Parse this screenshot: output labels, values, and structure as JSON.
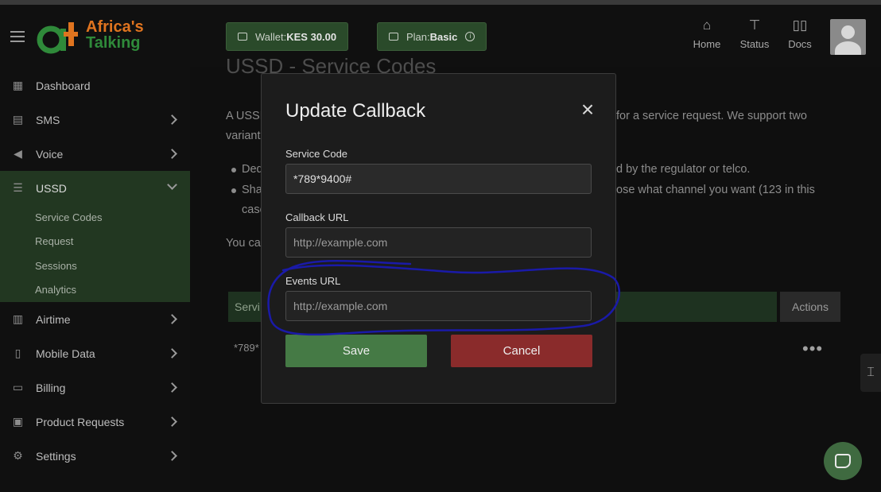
{
  "brand": {
    "line1": "Africa's",
    "line2": "Talking"
  },
  "sidebar": {
    "items": [
      {
        "label": "Dashboard",
        "icon": "dashboard-icon"
      },
      {
        "label": "SMS",
        "icon": "sms-icon"
      },
      {
        "label": "Voice",
        "icon": "voice-icon"
      },
      {
        "label": "USSD",
        "icon": "ussd-icon",
        "expanded": true,
        "subitems": [
          "Service Codes",
          "Request",
          "Sessions",
          "Analytics"
        ]
      },
      {
        "label": "Airtime",
        "icon": "airtime-icon"
      },
      {
        "label": "Mobile Data",
        "icon": "mobile-data-icon"
      },
      {
        "label": "Billing",
        "icon": "billing-icon"
      },
      {
        "label": "Product Requests",
        "icon": "product-requests-icon"
      },
      {
        "label": "Settings",
        "icon": "settings-icon"
      }
    ]
  },
  "topbar": {
    "wallet_label": "Wallet: ",
    "wallet_value": "KES 30.00",
    "plan_label": "Plan: ",
    "plan_value": "Basic",
    "nav": [
      {
        "label": "Home",
        "icon": "home-icon"
      },
      {
        "label": "Status",
        "icon": "status-icon"
      },
      {
        "label": "Docs",
        "icon": "docs-icon"
      }
    ]
  },
  "page": {
    "title": "USSD - Service Codes",
    "intro_line1_left": "A USSD",
    "intro_line1_right": "for a service request. We support two",
    "intro_line2": "variant",
    "bullet1_left": "Ded",
    "bullet1_right": "d by the regulator or telco.",
    "bullet2_left": "Sha",
    "bullet2_right": "ose what channel you want (123 in this",
    "bullet2_line2": "case",
    "para2": "You ca",
    "table_head_first": "Servi",
    "table_actions": "Actions",
    "row_code": "*789*",
    "row_actions": "•••"
  },
  "modal": {
    "title": "Update Callback",
    "service_code_label": "Service Code",
    "service_code_value": "*789*9400#",
    "callback_label": "Callback URL",
    "callback_placeholder": "http://example.com",
    "events_label": "Events URL",
    "events_placeholder": "http://example.com",
    "save_label": "Save",
    "cancel_label": "Cancel"
  },
  "colors": {
    "accent": "#457a45",
    "danger": "#8a2b2b",
    "annotation": "#1a1aa8"
  }
}
